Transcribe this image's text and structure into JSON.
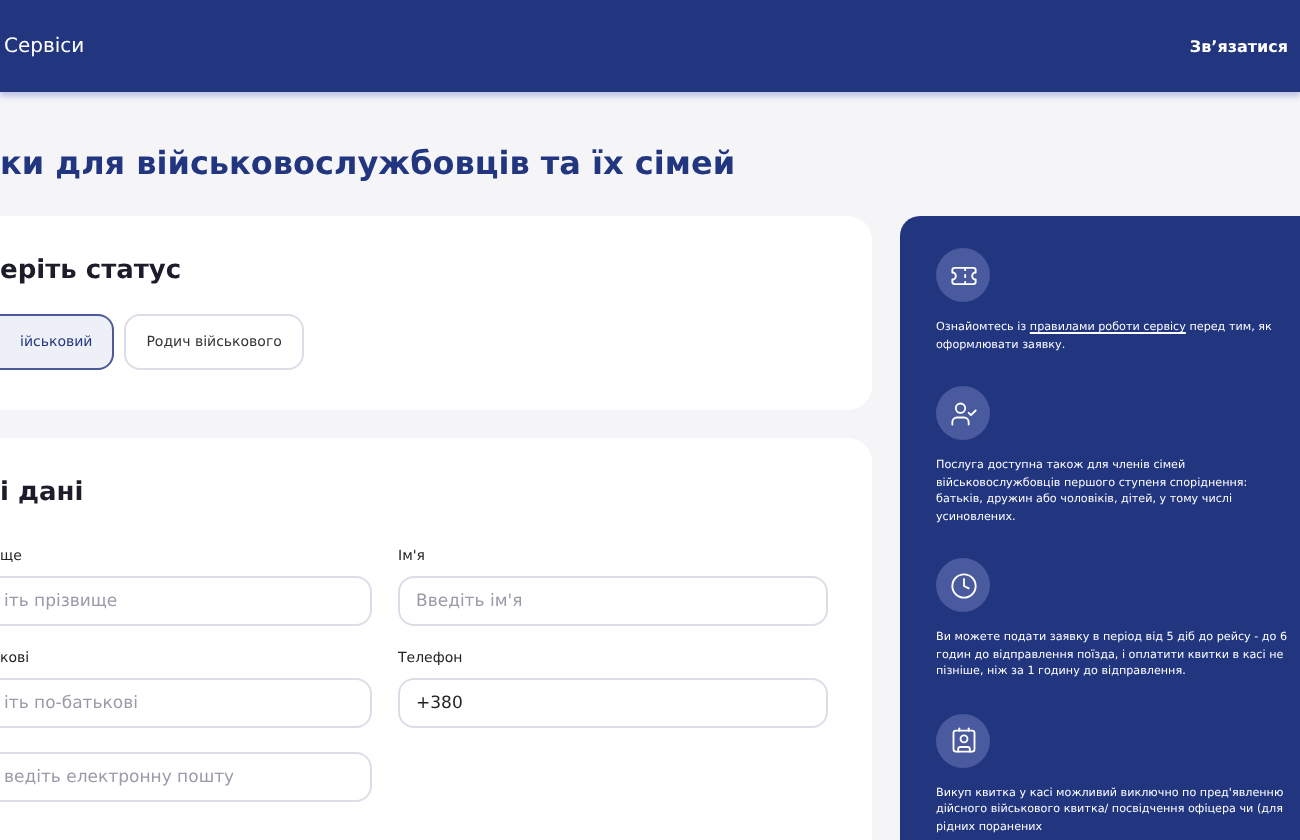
{
  "header": {
    "nav_label": "Сервіси",
    "contact_link": "Зв’язатися"
  },
  "page_title": "ки для військовослужбовців та їх сімей",
  "status_card": {
    "title": "ерiть статус",
    "options": [
      {
        "label": "ійськовий",
        "selected": true
      },
      {
        "label": "Родич військового",
        "selected": false
      }
    ]
  },
  "personal_card": {
    "title": "і дані",
    "fields": [
      {
        "label": "ще",
        "placeholder": "іть прізвище"
      },
      {
        "label": "Ім'я",
        "placeholder": "Введіть ім'я"
      },
      {
        "label": "кові",
        "placeholder": "іть по-батькові"
      },
      {
        "label": "Телефон",
        "value": "+380"
      },
      {
        "placeholder": "ведіть електронну пошту"
      }
    ]
  },
  "info_panel": {
    "items": [
      {
        "before": "Ознайомтесь із ",
        "link": "правилами роботи сервісу",
        "after": " перед тим, як оформлювати заявку."
      },
      {
        "before": "Послуга доступна також для членів сімей військовослужбовців першого ступеня споріднення: батьків, дружин або чоловіків, дітей, у тому числі усиновлених."
      },
      {
        "before": "Ви можете подати заявку в період від 5 діб до рейсу - до 6 годин до відправлення поїзда, і оплатити квитки в касі не пізніше, ніж за 1 годину до відправлення."
      },
      {
        "before": "Викуп квитка у касі можливий виключно по пред'явленню дійсного військового квитка/ посвідчення офіцера чи (для рідних поранених"
      }
    ]
  }
}
